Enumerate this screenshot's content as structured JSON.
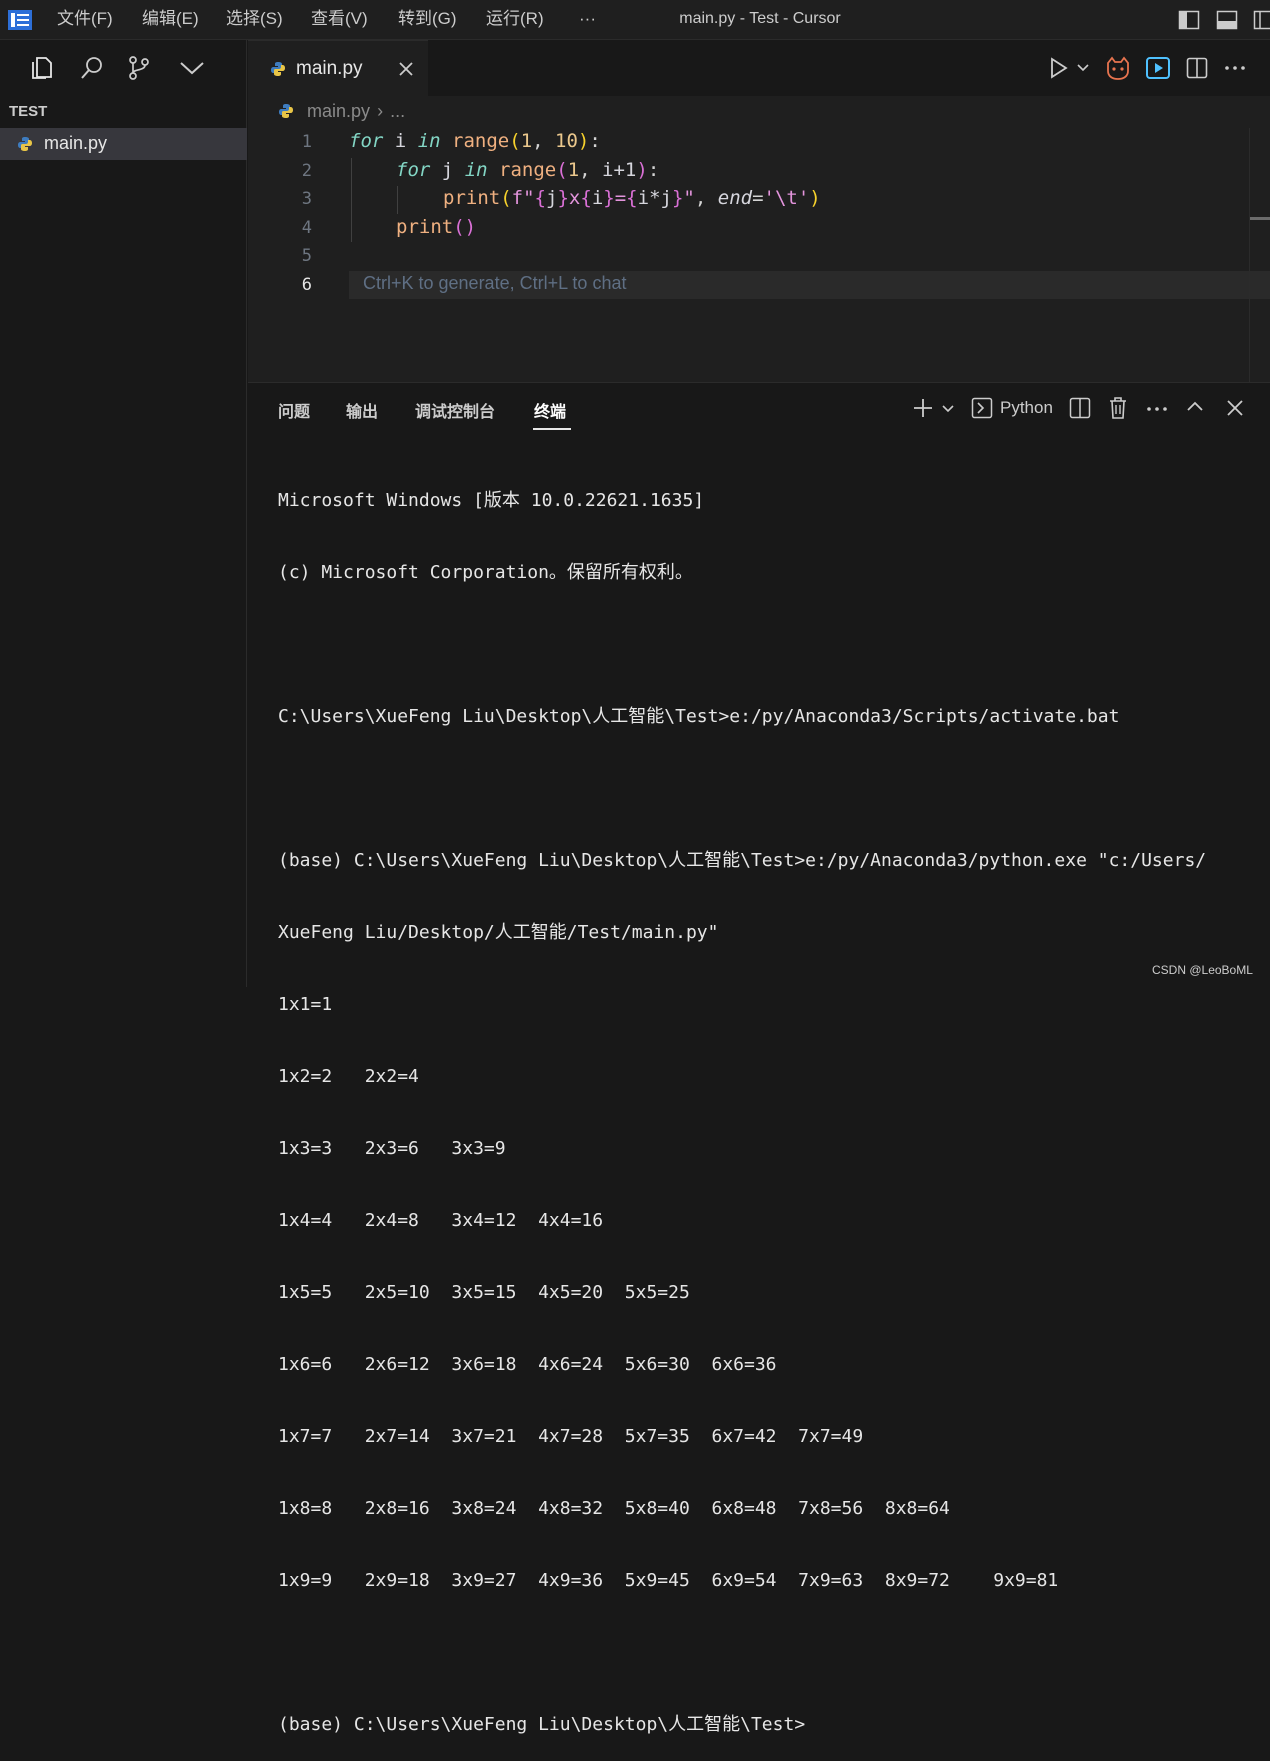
{
  "titlebar": {
    "menus": [
      "文件(F)",
      "编辑(E)",
      "选择(S)",
      "查看(V)",
      "转到(G)",
      "运行(R)",
      "···"
    ],
    "title": "main.py - Test - Cursor"
  },
  "sidebar": {
    "section_title": "TEST",
    "files": [
      "main.py"
    ]
  },
  "editor": {
    "tab_label": "main.py",
    "breadcrumb_file": "main.py",
    "breadcrumb_more": "...",
    "line_numbers": [
      "1",
      "2",
      "3",
      "4",
      "5",
      "6"
    ],
    "code": {
      "l1": {
        "kw_for": "for",
        "var_i": "i",
        "kw_in": "in",
        "fn_range": "range",
        "open": "(",
        "n1": "1",
        "sep": ", ",
        "n10": "10",
        "close": ")",
        "colon": ":"
      },
      "l2": {
        "kw_for": "for",
        "var_j": "j",
        "kw_in": "in",
        "fn_range": "range",
        "open": "(",
        "n1": "1",
        "sep": ", ",
        "expr": "i+1",
        "close": ")",
        "colon": ":"
      },
      "l3": {
        "fn_print": "print",
        "open": "(",
        "fstr_prefix": "f\"",
        "b1": "{",
        "j": "j",
        "b2": "}",
        "x": "x",
        "b3": "{",
        "i": "i",
        "b4": "}",
        "eq": "=",
        "b5": "{",
        "ij": "i*j",
        "b6": "}",
        "fstr_end": "\"",
        "comma": ", ",
        "kw_end": "end",
        "assign": "=",
        "tab_str": "'\\t'",
        "close": ")"
      },
      "l4": {
        "fn_print": "print",
        "parens": "()"
      }
    },
    "hint": "Ctrl+K to generate, Ctrl+L to chat"
  },
  "panel": {
    "tabs": [
      "问题",
      "输出",
      "调试控制台",
      "终端"
    ],
    "active_tab": "终端",
    "terminal_profile": "Python",
    "terminal_lines": [
      "Microsoft Windows [版本 10.0.22621.1635]",
      "(c) Microsoft Corporation。保留所有权利。",
      "",
      "C:\\Users\\XueFeng Liu\\Desktop\\人工智能\\Test>e:/py/Anaconda3/Scripts/activate.bat",
      "",
      "(base) C:\\Users\\XueFeng Liu\\Desktop\\人工智能\\Test>e:/py/Anaconda3/python.exe \"c:/Users/",
      "XueFeng Liu/Desktop/人工智能/Test/main.py\"",
      "1x1=1",
      "1x2=2   2x2=4",
      "1x3=3   2x3=6   3x3=9",
      "1x4=4   2x4=8   3x4=12  4x4=16",
      "1x5=5   2x5=10  3x5=15  4x5=20  5x5=25",
      "1x6=6   2x6=12  3x6=18  4x6=24  5x6=30  6x6=36",
      "1x7=7   2x7=14  3x7=21  4x7=28  5x7=35  6x7=42  7x7=49",
      "1x8=8   2x8=16  3x8=24  4x8=32  5x8=40  6x8=48  7x8=56  8x8=64",
      "1x9=9   2x9=18  3x9=27  4x9=36  5x9=45  6x9=54  7x9=63  8x9=72    9x9=81",
      "",
      "(base) C:\\Users\\XueFeng Liu\\Desktop\\人工智能\\Test>"
    ]
  },
  "watermark": "CSDN @LeoBoML",
  "colors": {
    "background": "#181818",
    "editor_bg": "#1f1f1f",
    "accent_blue": "#4fc1ff",
    "keyword": "#83d6c5",
    "function": "#efb080",
    "number": "#ebc88d",
    "string": "#e394dc"
  }
}
